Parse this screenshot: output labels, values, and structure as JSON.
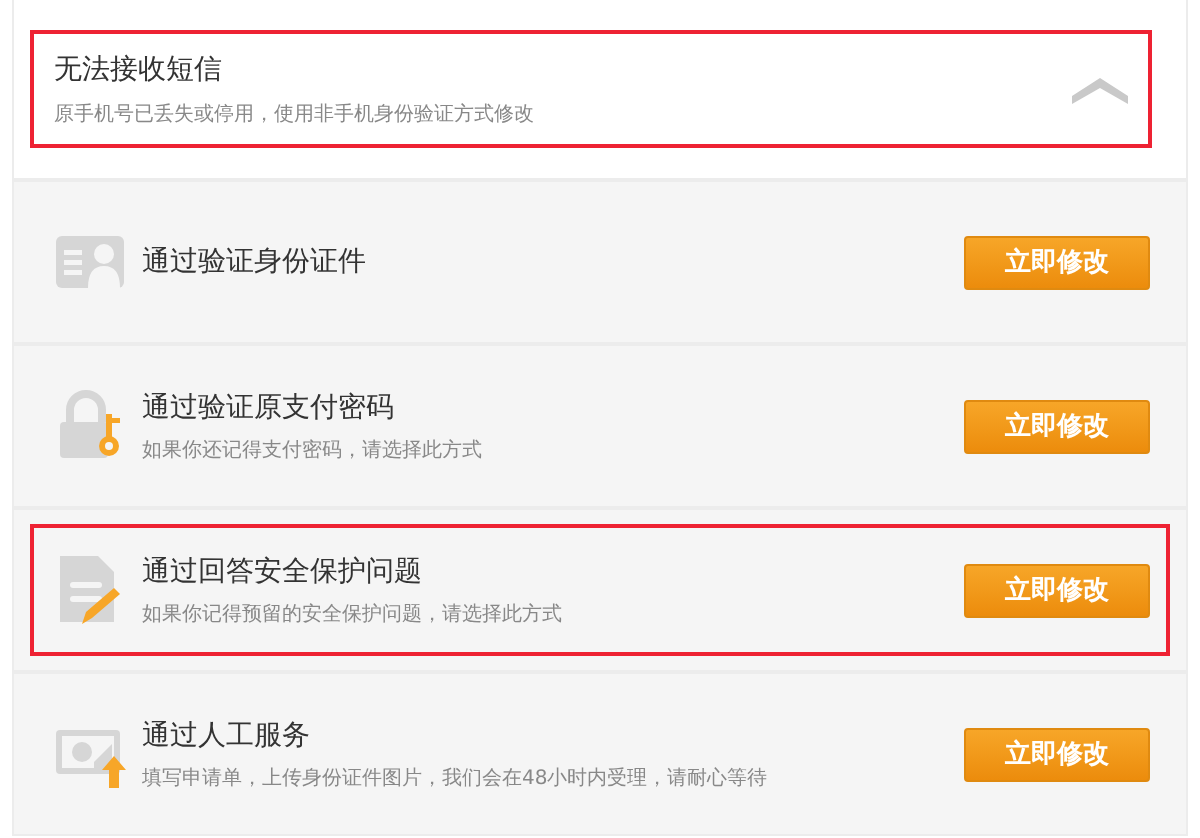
{
  "header": {
    "title": "无法接收短信",
    "subtitle": "原手机号已丢失或停用，使用非手机身份验证方式修改",
    "expanded": true,
    "highlighted": true
  },
  "options": [
    {
      "kind": "idcard",
      "title": "通过验证身份证件",
      "button": "立即修改",
      "highlighted": false
    },
    {
      "kind": "password",
      "title": "通过验证原支付密码",
      "description": "如果你还记得支付密码，请选择此方式",
      "button": "立即修改",
      "highlighted": false
    },
    {
      "kind": "question",
      "title": "通过回答安全保护问题",
      "description": "如果你记得预留的安全保护问题，请选择此方式",
      "button": "立即修改",
      "highlighted": true
    },
    {
      "kind": "manual",
      "title": "通过人工服务",
      "description": "填写申请单，上传身份证件图片，我们会在48小时内受理，请耐心等待",
      "button": "立即修改",
      "highlighted": false
    }
  ]
}
